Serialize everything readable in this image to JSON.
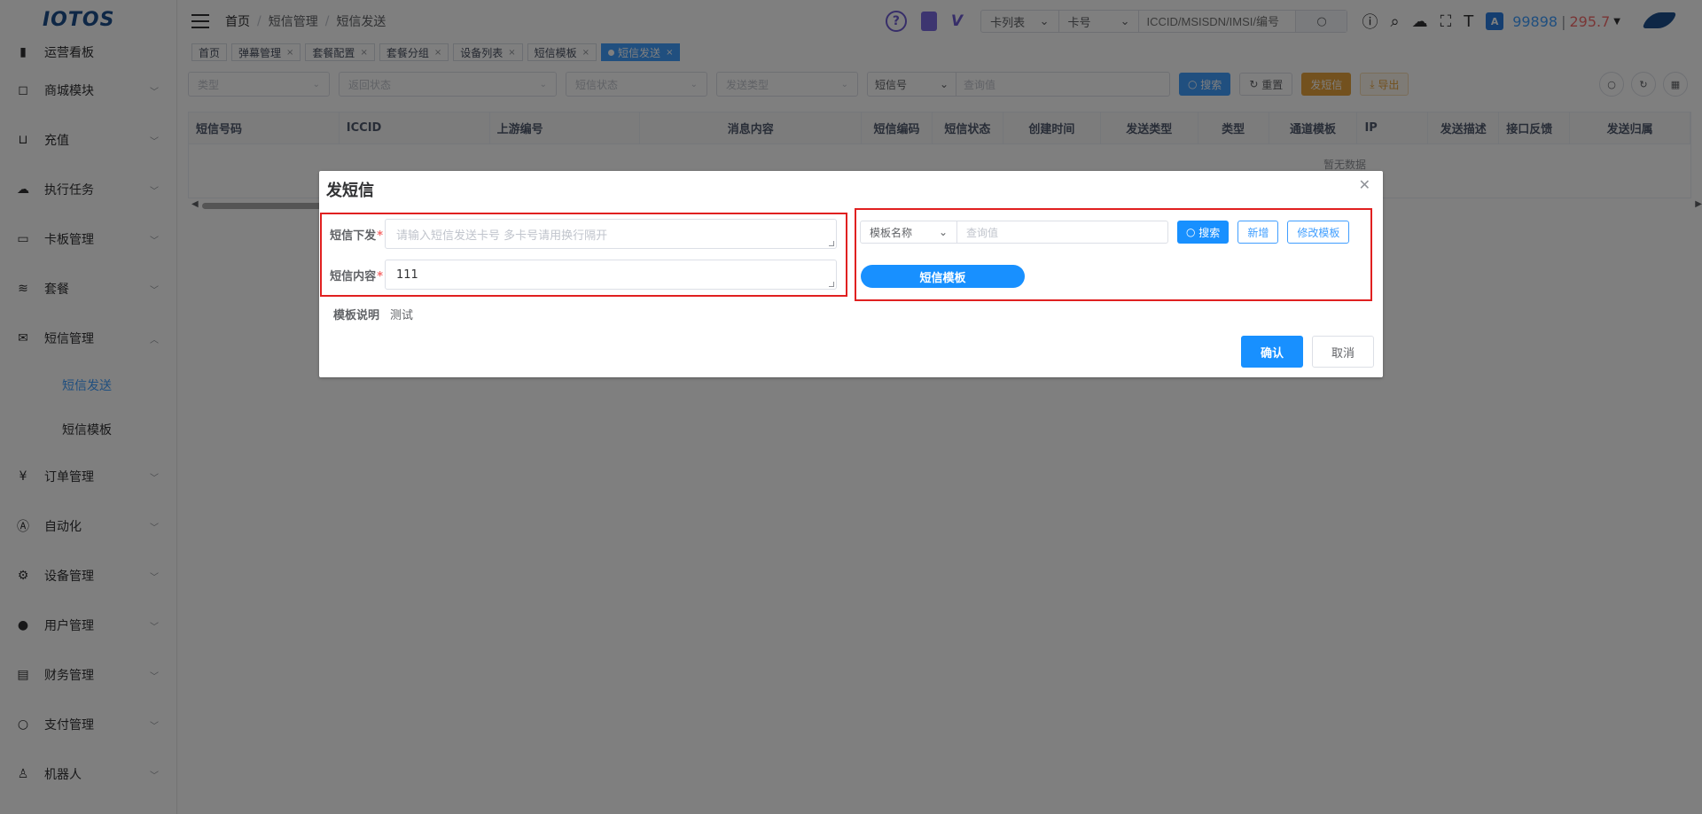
{
  "app": {
    "logo_text": "IOTOS"
  },
  "sidebar": {
    "items": [
      {
        "icon": "bar-chart-icon",
        "label": "运营看板"
      },
      {
        "icon": "bag-icon",
        "label": "商城模块"
      },
      {
        "icon": "cart-icon",
        "label": "充值"
      },
      {
        "icon": "cloud-icon",
        "label": "执行任务"
      },
      {
        "icon": "card-icon",
        "label": "卡板管理"
      },
      {
        "icon": "layers-icon",
        "label": "套餐"
      },
      {
        "icon": "mail-icon",
        "label": "短信管理"
      },
      {
        "icon": "yen-icon",
        "label": "订单管理"
      },
      {
        "icon": "auto-icon",
        "label": "自动化"
      },
      {
        "icon": "device-icon",
        "label": "设备管理"
      },
      {
        "icon": "user-icon",
        "label": "用户管理"
      },
      {
        "icon": "finance-icon",
        "label": "财务管理"
      },
      {
        "icon": "pay-icon",
        "label": "支付管理"
      },
      {
        "icon": "robot-icon",
        "label": "机器人"
      }
    ],
    "sub_items": [
      {
        "label": "短信发送",
        "active": true
      },
      {
        "label": "短信模板",
        "active": false
      }
    ]
  },
  "header": {
    "breadcrumb": [
      "首页",
      "短信管理",
      "短信发送"
    ],
    "search": {
      "select1": "卡列表",
      "select2": "卡号",
      "placeholder": "ICCID/MSISDN/IMSI/编号"
    },
    "balance_blue": "99898",
    "balance_sep": "|",
    "balance_red": "295.7"
  },
  "tags": [
    {
      "label": "首页",
      "closable": false,
      "active": false
    },
    {
      "label": "弹幕管理",
      "closable": true,
      "active": false
    },
    {
      "label": "套餐配置",
      "closable": true,
      "active": false
    },
    {
      "label": "套餐分组",
      "closable": true,
      "active": false
    },
    {
      "label": "设备列表",
      "closable": true,
      "active": false
    },
    {
      "label": "短信模板",
      "closable": true,
      "active": false
    },
    {
      "label": "短信发送",
      "closable": true,
      "active": true
    }
  ],
  "filters": {
    "type": "类型",
    "return_status": "返回状态",
    "sms_status": "短信状态",
    "send_type": "发送类型",
    "query_field": "短信号",
    "query_placeholder": "查询值",
    "search_label": "搜索",
    "reset_label": "重置",
    "send_label": "发短信",
    "export_label": "导出"
  },
  "table": {
    "columns": [
      "短信号码",
      "ICCID",
      "上游编号",
      "消息内容",
      "短信编码",
      "短信状态",
      "创建时间",
      "发送类型",
      "类型",
      "通道模板",
      "IP",
      "发送描述",
      "接口反馈",
      "发送归属"
    ],
    "empty_text": "暂无数据"
  },
  "dialog": {
    "title": "发短信",
    "field_send_label": "短信下发",
    "field_send_placeholder": "请输入短信发送卡号 多卡号请用换行隔开",
    "field_content_label": "短信内容",
    "field_content_value": "111",
    "desc_label": "模板说明",
    "desc_value": "测试",
    "template_search": {
      "field": "模板名称",
      "placeholder": "查询值",
      "search_label": "搜索",
      "add_label": "新增",
      "edit_label": "修改模板"
    },
    "template_tag": "短信模板",
    "confirm_label": "确认",
    "cancel_label": "取消"
  }
}
